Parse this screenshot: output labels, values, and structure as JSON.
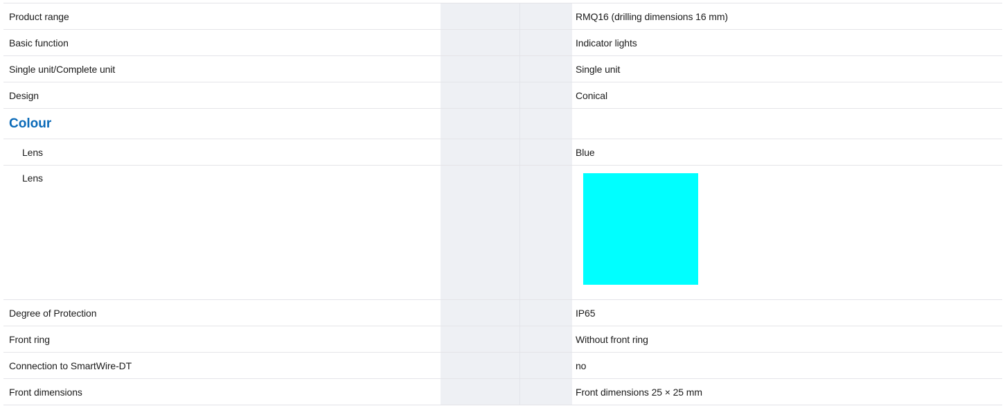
{
  "rows": [
    {
      "label": "Product range",
      "value": "RMQ16 (drilling dimensions 16 mm)"
    },
    {
      "label": "Basic function",
      "value": "Indicator lights"
    },
    {
      "label": "Single unit/Complete unit",
      "value": "Single unit"
    },
    {
      "label": "Design",
      "value": "Conical"
    }
  ],
  "section": {
    "heading": "Colour",
    "lens_label": "Lens",
    "lens_value": "Blue",
    "lens_swatch_label": "Lens",
    "lens_swatch_color": "#00ffff"
  },
  "rows_after": [
    {
      "label": "Degree of Protection",
      "value": "IP65"
    },
    {
      "label": "Front ring",
      "value": "Without front ring"
    },
    {
      "label": "Connection to SmartWire-DT",
      "value": "no"
    },
    {
      "label": "Front dimensions",
      "value": "Front dimensions 25 × 25 mm"
    }
  ]
}
